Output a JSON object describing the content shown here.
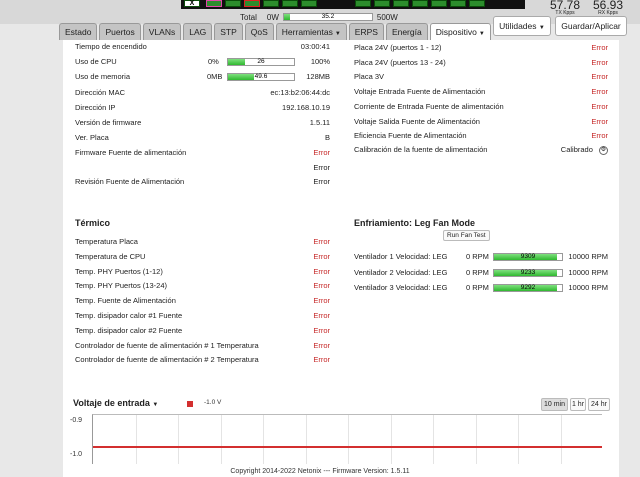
{
  "header": {
    "total_label": "Total",
    "power_min": "0W",
    "power_value": "35.2",
    "power_fraction": 0.07,
    "power_max": "500W",
    "tx_value": "57.78",
    "tx_label": "TX Kpps",
    "rx_value": "56.93",
    "rx_label": "RX Kpps"
  },
  "tabs": [
    {
      "label": "Estado"
    },
    {
      "label": "Puertos"
    },
    {
      "label": "VLANs"
    },
    {
      "label": "LAG"
    },
    {
      "label": "STP"
    },
    {
      "label": "QoS"
    },
    {
      "label": "Herramientas",
      "dropdown": true
    },
    {
      "label": "ERPS"
    },
    {
      "label": "Energía"
    },
    {
      "label": "Dispositivo",
      "dropdown": true,
      "active": true
    }
  ],
  "toolbar": {
    "utilities_label": "Utilidades",
    "save_label": "Guardar/Aplicar"
  },
  "status": {
    "uptime_label": "Tiempo de encendido",
    "uptime_value": "03:00:41",
    "cpu_label": "Uso de CPU",
    "cpu_min": "0%",
    "cpu_value": "26",
    "cpu_fraction": 0.26,
    "cpu_max": "100%",
    "mem_label": "Uso de memoria",
    "mem_min": "0MB",
    "mem_value": "49.6",
    "mem_fraction": 0.39,
    "mem_max": "128MB",
    "mac_label": "Dirección MAC",
    "mac_value": "ec:13:b2:06:44:dc",
    "ip_label": "Dirección IP",
    "ip_value": "192.168.10.19",
    "fw_label": "Versión de firmware",
    "fw_value": "1.5.11",
    "board_label": "Ver. Placa",
    "board_value": "B",
    "psu_fw_label": "Firmware Fuente de alimentación",
    "psu_fw_value": "Error",
    "psu_fw_value2": "Error",
    "psu_rev_label": "Revisión Fuente de Alimentación",
    "psu_rev_value": "Error"
  },
  "power": {
    "items": [
      {
        "label": "Placa 24V (puertos 1 - 12)",
        "value": "Error"
      },
      {
        "label": "Placa 24V (puertos 13 - 24)",
        "value": "Error"
      },
      {
        "label": "Placa 3V",
        "value": "Error"
      },
      {
        "label": "Voltaje Entrada Fuente de Alimentación",
        "value": "Error"
      },
      {
        "label": "Corriente de Entrada Fuente de alimentación",
        "value": "Error"
      },
      {
        "label": "Voltaje Salida Fuente de Alimentación",
        "value": "Error"
      },
      {
        "label": "Eficiencia Fuente de Alimentación",
        "value": "Error"
      }
    ],
    "calib_label": "Calibración de la fuente de alimentación",
    "calib_value": "Calibrado"
  },
  "thermal": {
    "title": "Térmico",
    "items": [
      {
        "label": "Temperatura Placa",
        "value": "Error"
      },
      {
        "label": "Temperatura de CPU",
        "value": "Error"
      },
      {
        "label": "Temp. PHY Puertos (1-12)",
        "value": "Error"
      },
      {
        "label": "Temp. PHY Puertos (13-24)",
        "value": "Error"
      },
      {
        "label": "Temp. Fuente de Alimentación",
        "value": "Error"
      },
      {
        "label": "Temp. disipador calor #1 Fuente",
        "value": "Error"
      },
      {
        "label": "Temp. disipador calor #2 Fuente",
        "value": "Error"
      },
      {
        "label": "Controlador de fuente de alimentación # 1 Temperatura",
        "value": "Error"
      },
      {
        "label": "Controlador de fuente de alimentación # 2 Temperatura",
        "value": "Error"
      }
    ]
  },
  "cooling": {
    "title": "Enfriamiento: Leg Fan Mode",
    "test_label": "Run Fan Test",
    "fans": [
      {
        "label": "Ventilador 1 Velocidad: LEG",
        "min": "0 RPM",
        "value": "9309",
        "fraction": 0.93,
        "max": "10000 RPM"
      },
      {
        "label": "Ventilador 2 Velocidad: LEG",
        "min": "0 RPM",
        "value": "9233",
        "fraction": 0.92,
        "max": "10000 RPM"
      },
      {
        "label": "Ventilador 3 Velocidad: LEG",
        "min": "0 RPM",
        "value": "9292",
        "fraction": 0.93,
        "max": "10000 RPM"
      }
    ]
  },
  "voltage_chart": {
    "title": "Voltaje de entrada",
    "legend_value": "-1.0 V",
    "series_color": "#d32f2f",
    "ranges": [
      {
        "label": "10 min",
        "selected": true
      },
      {
        "label": "1 hr"
      },
      {
        "label": "24 hr"
      }
    ],
    "ytick_top": "-0.9",
    "ytick_line": "-1.0",
    "ylim": [
      -1.02,
      -0.9
    ],
    "value": -1.0
  },
  "footer": {
    "text": "Copyright 2014-2022 Netonix --- Firmware Version: 1.5.11"
  }
}
